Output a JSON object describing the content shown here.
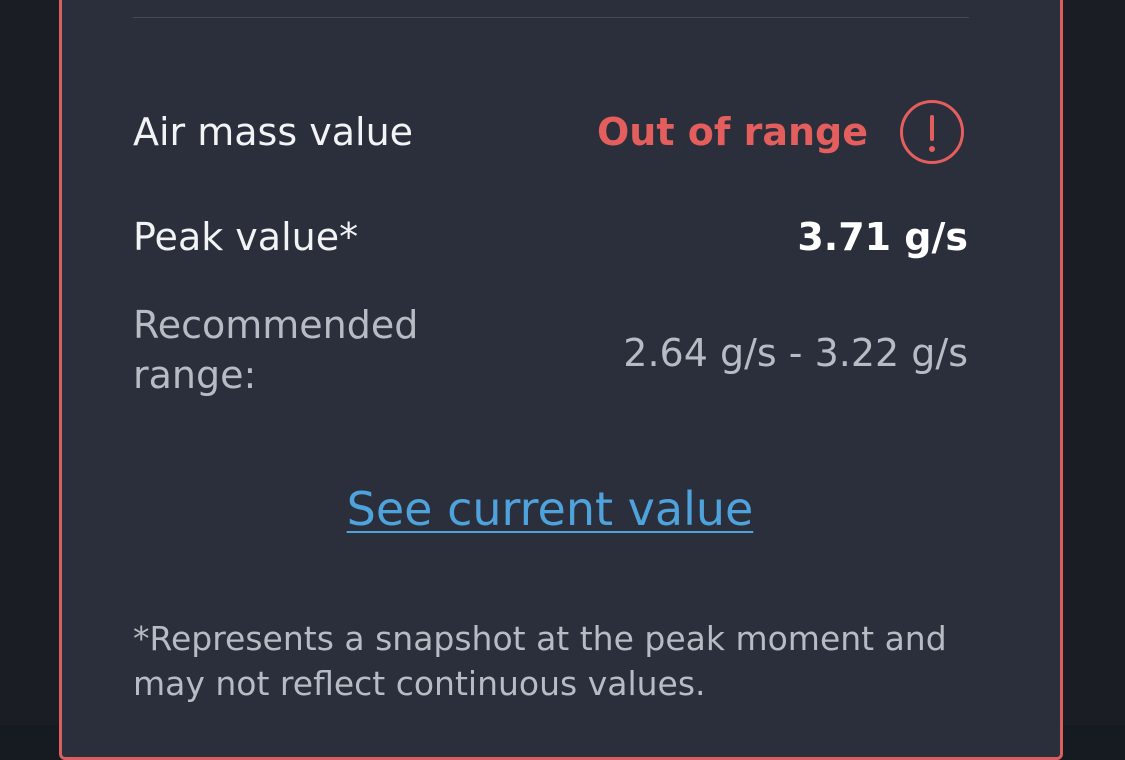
{
  "colors": {
    "accent_alert": "#e35e5c",
    "link": "#4fa3dc",
    "card_bg": "#2a2f3b",
    "card_border": "#d9605f"
  },
  "air_mass": {
    "label": "Air mass value",
    "status": "Out of range",
    "status_icon": "exclamation-circle-icon"
  },
  "peak": {
    "label": "Peak value*",
    "value": "3.71 g/s"
  },
  "recommended": {
    "label": "Recommended range:",
    "value": "2.64 g/s - 3.22 g/s"
  },
  "link": {
    "label": "See current value"
  },
  "footnote": "*Represents a snapshot at the peak moment and may not reflect continuous values."
}
